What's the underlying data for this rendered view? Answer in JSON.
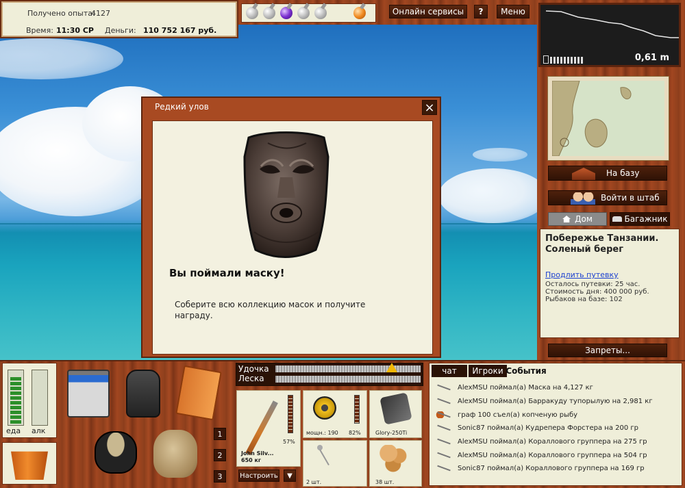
{
  "info": {
    "exp_label": "Получено опыта:",
    "exp_value": "4127",
    "time_label": "Время:",
    "time_value": "11:30 СР",
    "money_label": "Деньги:",
    "money_value": "110 752 167 руб."
  },
  "potions": [
    "flask-icon",
    "flask-icon",
    "purple-flask-icon",
    "flask-icon",
    "flask-icon",
    "orange-flask-icon"
  ],
  "top_buttons": {
    "online": "Онлайн сервисы",
    "help": "?",
    "menu": "Меню"
  },
  "depth": {
    "value": "0,61 m"
  },
  "right_panel": {
    "base_button": "На базу",
    "hq_button": "Войти в штаб",
    "home_tab": "Дом",
    "trunk_tab": "Багажник",
    "location_title": "Побережье Танзании. Соленый берег",
    "extend_link": "Продлить путевку",
    "days_left": "Осталось путевки: 25 час.",
    "day_cost": "Стоимость дня: 400 000 руб.",
    "anglers": "Рыбаков на базе: 102",
    "bans_button": "Запреты..."
  },
  "popup": {
    "title": "Редкий улов",
    "close": "×",
    "headline": "Вы поймали маску!",
    "message": "Соберите всю коллекцию масок и получите награду."
  },
  "gauges": {
    "food_label": "еда",
    "alc_label": "алк",
    "food_level": 0.75,
    "alc_level": 0.0
  },
  "inventory_numbers": [
    "1",
    "2",
    "3"
  ],
  "rod_bar": {
    "rod_label": "Удочка",
    "line_label": "Леска"
  },
  "tackle": {
    "rod_owner": "John Silv...",
    "rod_weight": "650 кг",
    "rod_percent": "57%",
    "reel_power": "мощн.: 190",
    "reel_percent": "82%",
    "line_name": "Glory-250Ti",
    "hooks_count": "2 шт.",
    "bait_count": "38 шт.",
    "configure_button": "Настроить",
    "dropdown_arrow": "▼"
  },
  "tabs": {
    "chat": "чат",
    "players": "Игроки",
    "events": "События"
  },
  "events": [
    "AlexMSU поймал(а) Маска на 4,127 кг",
    "AlexMSU поймал(а) Барракуду тупорылую на 2,981 кг",
    "граф 100 съел(а) копченую рыбу",
    "Sonic87 поймал(а) Кудрепера Форстера на 200 гр",
    "AlexMSU поймал(а) Кораллового группера на 275 гр",
    "AlexMSU поймал(а) Кораллового группера на 504 гр",
    "Sonic87 поймал(а) Кораллового группера на 169 гр"
  ]
}
